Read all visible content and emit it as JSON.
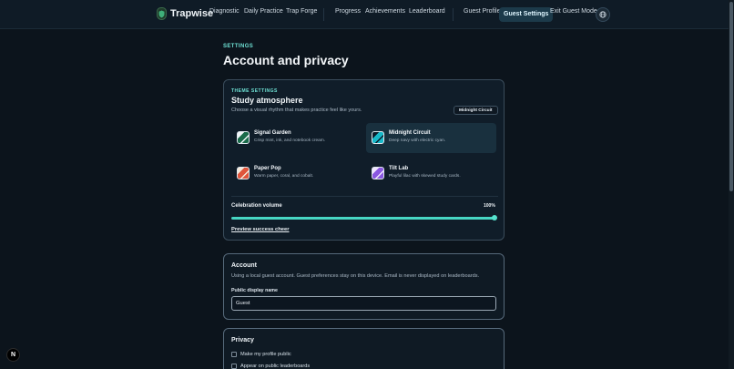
{
  "header": {
    "brand": "Trapwise",
    "nav_primary": [
      "Diagnostic",
      "Daily Practice",
      "Trap Forge"
    ],
    "nav_secondary": [
      "Progress",
      "Achievements",
      "Leaderboard"
    ],
    "guest_profile": "Guest Profile",
    "guest_settings": "Guest Settings",
    "exit_guest": "Exit Guest Mode",
    "lang_icon": "globe-icon"
  },
  "page": {
    "eyebrow": "SETTINGS",
    "title": "Account and privacy"
  },
  "theme": {
    "eyebrow": "THEME SETTINGS",
    "title": "Study atmosphere",
    "description": "Choose a visual rhythm that makes practice feel like yours.",
    "current_badge": "Midnight Circuit",
    "options": [
      {
        "name": "Signal Garden",
        "desc": "Crisp mint, ink, and notebook cream.",
        "colors": [
          "#1a6b4a",
          "#f1f5f8"
        ],
        "selected": false
      },
      {
        "name": "Midnight Circuit",
        "desc": "Deep navy with electric cyan.",
        "colors": [
          "#17b8c9",
          "#0d1b2a"
        ],
        "selected": true
      },
      {
        "name": "Paper Pop",
        "desc": "Warm paper, coral, and cobalt.",
        "colors": [
          "#e0553c",
          "#f5eadb"
        ],
        "selected": false
      },
      {
        "name": "Tilt Lab",
        "desc": "Playful lilac with skewed study cards.",
        "colors": [
          "#8a57e0",
          "#efe6ff"
        ],
        "selected": false
      }
    ],
    "volume_label": "Celebration volume",
    "volume_value": "100%",
    "volume_level": 1.0,
    "preview_link": "Preview success cheer"
  },
  "account": {
    "title": "Account",
    "description": "Using a local guest account. Guest preferences stay on this device. Email is never displayed on leaderboards.",
    "display_name_label": "Public display name",
    "display_name_value": "Guest"
  },
  "privacy": {
    "title": "Privacy",
    "options": [
      "Make my profile public",
      "Appear on public leaderboards"
    ]
  },
  "dev_badge": "N",
  "colors": {
    "background": "#0c141c",
    "accent": "#6fe3d6",
    "slider": "#47d6c3"
  }
}
